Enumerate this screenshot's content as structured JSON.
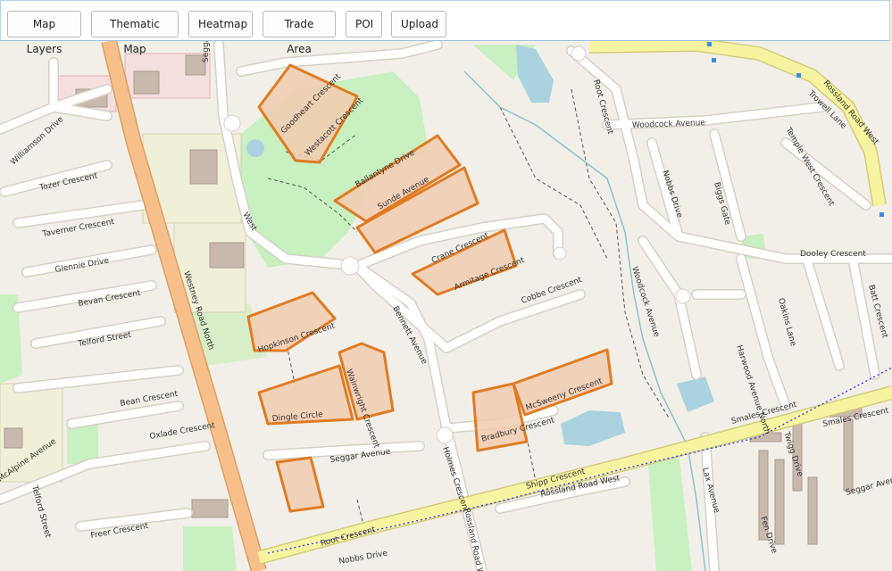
{
  "toolbar": {
    "buttons": [
      {
        "id": "map-layers",
        "label": "Map Layers"
      },
      {
        "id": "thematic-map",
        "label": "Thematic Map"
      },
      {
        "id": "heatmap",
        "label": "Heatmap"
      },
      {
        "id": "trade-area",
        "label": "Trade Area"
      },
      {
        "id": "poi",
        "label": "POI"
      },
      {
        "id": "upload",
        "label": "Upload"
      }
    ]
  },
  "map": {
    "colors": {
      "background": "#f2efe9",
      "road": "#ffffff",
      "major_road": "#f7c08a",
      "highway": "#f7f4a1",
      "park": "#c8f0c0",
      "parcel_fill": "#f2cbb0",
      "parcel_outline": "#e07b22",
      "water": "#aad3df",
      "rail": "#5050ff"
    },
    "street_labels": [
      "Westney Road North",
      "Seggar Avenue",
      "Williamson Drive",
      "Tozer Crescent",
      "Taverner Crescent",
      "Glennie Drive",
      "Bevan Crescent",
      "Telford Street",
      "Bean Crescent",
      "Oxlade Crescent",
      "Freer Crescent",
      "Telford Street",
      "McAlpine Avenue",
      "Goodheart Crescent",
      "Westacott Crescent",
      "Ballantyne Drive",
      "Sunde Avenue",
      "Crane Crescent",
      "Armitage Crescent",
      "Cobbe Crescent",
      "Hopkinson Crescent",
      "Dingle Circle",
      "Wainwright Crescent",
      "Bradbury Crescent",
      "McSweeny Crescent",
      "Seggar Avenue",
      "Bennett Avenue",
      "Holmes Crescent",
      "Rossland Road West",
      "Rossland Road West",
      "Shipp Crescent",
      "Root Crescent",
      "Nobbs Drive",
      "Root Crescent",
      "Woodcock Avenue",
      "Nobbs Drive",
      "Biggs Gate",
      "Temple West Crescent",
      "Dooley Crescent",
      "Woodcock Avenue",
      "Oakins Lane",
      "Harwood Avenue North",
      "Batt Crescent",
      "Rossland Road West",
      "Trowell Lane",
      "Smales Crescent",
      "Smales Crescent",
      "Twigg Drive",
      "Lax Avenue",
      "Seggar Avenue",
      "Fen Drive",
      "West"
    ]
  }
}
